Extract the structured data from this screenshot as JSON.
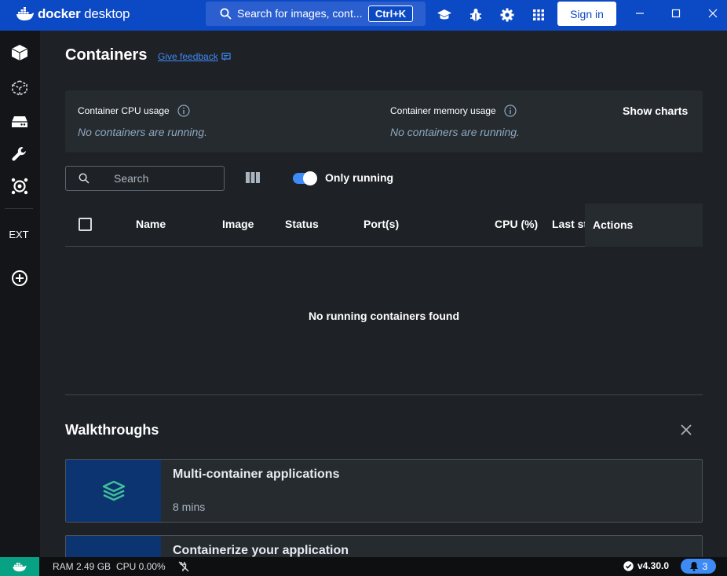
{
  "app": {
    "logo_bold": "docker",
    "logo_light": "desktop"
  },
  "titlebar": {
    "search_text": "Search for images, cont...",
    "shortcut": "Ctrl+K",
    "sign_in": "Sign in"
  },
  "sidebar": {
    "ext_label": "EXT"
  },
  "header": {
    "title": "Containers",
    "feedback": "Give feedback"
  },
  "stats": {
    "cpu_label": "Container CPU usage",
    "cpu_value": "No containers are running.",
    "mem_label": "Container memory usage",
    "mem_value": "No containers are running.",
    "show_charts": "Show charts"
  },
  "toolbar": {
    "search_placeholder": "Search",
    "only_running": "Only running",
    "only_running_enabled": true
  },
  "table": {
    "columns": [
      "Name",
      "Image",
      "Status",
      "Port(s)",
      "CPU (%)",
      "Last st",
      "Actions"
    ],
    "empty_message": "No running containers found"
  },
  "walkthroughs": {
    "title": "Walkthroughs",
    "cards": [
      {
        "title": "Multi-container applications",
        "duration": "8 mins"
      },
      {
        "title": "Containerize your application",
        "duration": ""
      }
    ]
  },
  "statusbar": {
    "ram": "RAM 2.49 GB",
    "cpu": "CPU 0.00%",
    "version": "v4.30.0",
    "notifications": "3"
  },
  "colors": {
    "brand_blue": "#0c49c5",
    "accent": "#3e8bf6",
    "status_green": "#07a283"
  }
}
